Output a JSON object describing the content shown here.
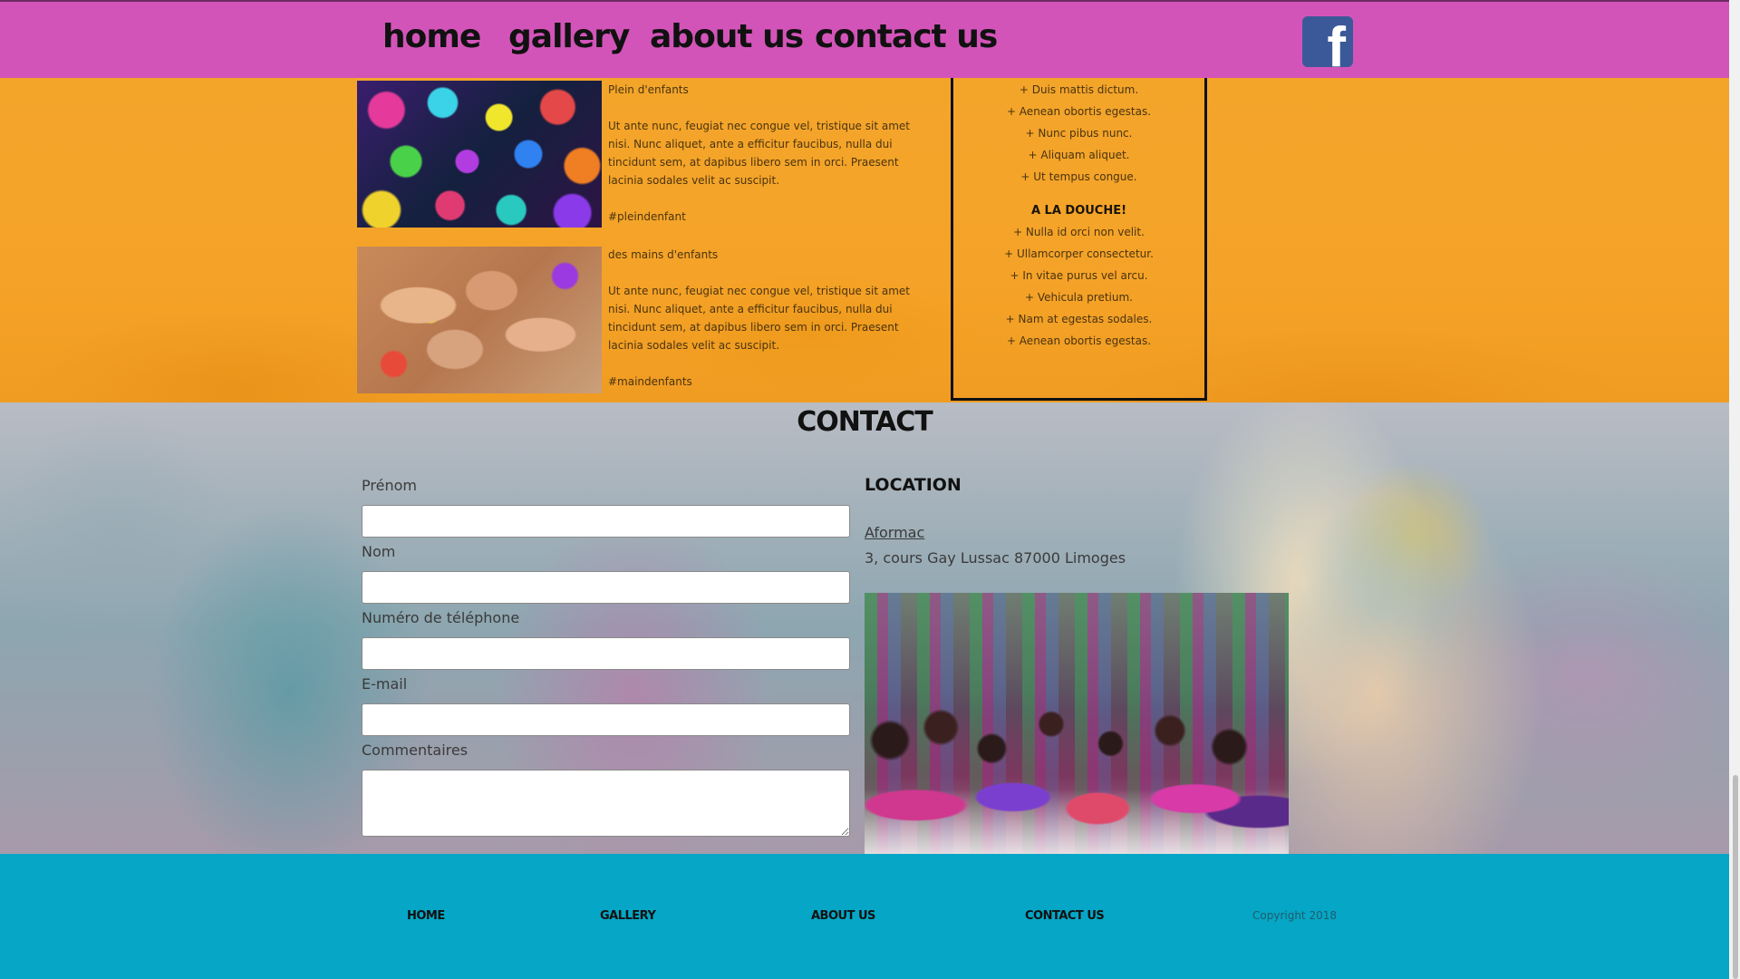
{
  "nav": {
    "links": [
      "home",
      "gallery",
      "about us",
      "contact us"
    ],
    "social_icon": "facebook-icon",
    "background": "#d354b9"
  },
  "blog": {
    "posts": [
      {
        "title": "Plein d'enfants",
        "body": "Ut ante nunc, feugiat nec congue vel, tristique sit amet nisi. Nunc aliquet, ante a efficitur faucibus, nulla dui tincidunt sem, at dapibus libero sem in orci. Praesent lacinia sodales velit ac suscipit.",
        "tag": "#pleindenfant"
      },
      {
        "title": "des mains d'enfants",
        "body": "Ut ante nunc, feugiat nec congue vel, tristique sit amet nisi. Nunc aliquet, ante a efficitur faucibus, nulla dui tincidunt sem, at dapibus libero sem in orci. Praesent lacinia sodales velit ac suscipit.",
        "tag": "#maindenfants"
      }
    ]
  },
  "sidebar": {
    "list_top": [
      "+ Duis mattis dictum.",
      "+ Aenean obortis egestas.",
      "+ Nunc pibus nunc.",
      "+ Aliquam aliquet.",
      "+ Ut tempus congue."
    ],
    "heading": "A LA DOUCHE!",
    "list_bottom": [
      "+ Nulla id orci non velit.",
      "+ Ullamcorper consectetur.",
      "+ In vitae purus vel arcu.",
      "+ Vehicula pretium.",
      "+ Nam at egestas sodales.",
      "+ Aenean obortis egestas."
    ]
  },
  "contact": {
    "title": "CONTACT",
    "fields": {
      "prenom_label": "Prénom",
      "nom_label": "Nom",
      "phone_label": "Numéro de téléphone",
      "email_label": "E-mail",
      "comments_label": "Commentaires"
    },
    "location": {
      "title": "LOCATION",
      "link": "Aformac",
      "address": "3, cours Gay Lussac 87000 Limoges"
    }
  },
  "footer": {
    "links": [
      "HOME",
      "GALLERY",
      "ABOUT US",
      "CONTACT US"
    ],
    "copyright": "Copyright 2018",
    "background": "#05a6c6"
  }
}
